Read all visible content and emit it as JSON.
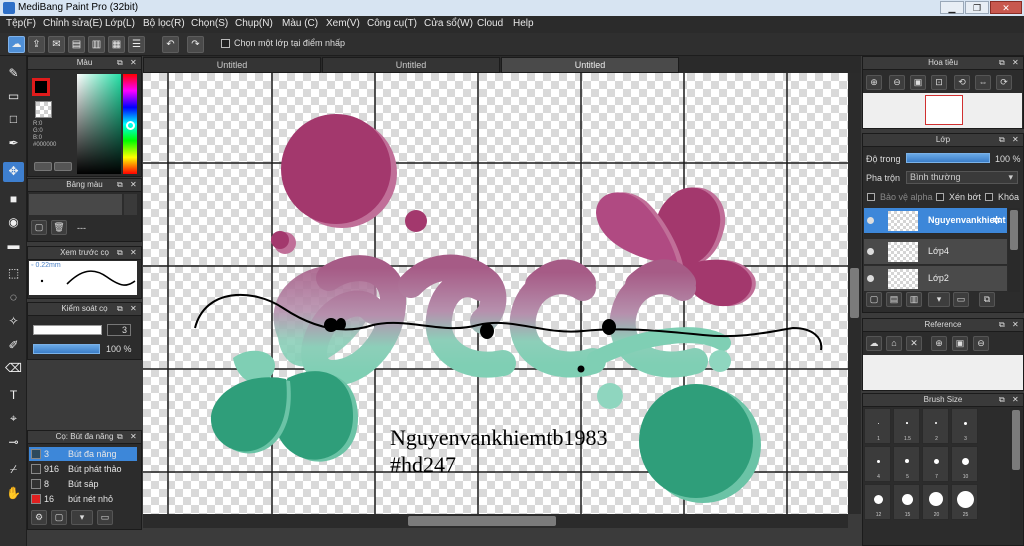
{
  "window": {
    "title": "MediBang Paint Pro (32bit)"
  },
  "menu": [
    "Tệp(F)",
    "Chỉnh sửa(E)",
    "Lớp(L)",
    "Bộ lọc(R)",
    "Chọn(S)",
    "Chụp(N)",
    "Màu (C)",
    "Xem(V)",
    "Công cụ(T)",
    "Cửa sổ(W)",
    "Cloud",
    "Help"
  ],
  "toolbar": {
    "select_layer_option": "Chọn một lớp tại điểm nhấp"
  },
  "left_panels": {
    "color": {
      "title": "Màu",
      "r": "R:0",
      "g": "G:0",
      "b": "B:0",
      "hex": "#000000",
      "fg_color": "#000000",
      "bg_color": "transparent"
    },
    "palette": {
      "title": "Bảng màu",
      "dash": "---"
    },
    "preview": {
      "title": "Xem trước cọ",
      "size": "0.22mm"
    },
    "brush_control": {
      "title": "Kiểm soát cọ",
      "size_value": "3",
      "opacity_value": "100 %"
    },
    "brush_list": {
      "title": "Cọ: Bút đa năng",
      "items": [
        {
          "size": "3",
          "name": "Bút đa năng",
          "color": "#2d4a5c",
          "selected": true
        },
        {
          "size": "916",
          "name": "Bút phát thảo",
          "color": "#333333",
          "selected": false
        },
        {
          "size": "8",
          "name": "Bút sáp",
          "color": "#333333",
          "selected": false
        },
        {
          "size": "16",
          "name": "bút nét nhỏ",
          "color": "#e02020",
          "selected": false
        }
      ]
    }
  },
  "tabs": [
    {
      "label": "Untitled",
      "active": false
    },
    {
      "label": "Untitled",
      "active": false
    },
    {
      "label": "Untitled",
      "active": true
    }
  ],
  "canvas": {
    "signature_line1": "Nguyenvankhiemtb1983",
    "signature_line2": "#hd247",
    "colors": {
      "magenta": "#a3386d",
      "teal": "#2f9e7a",
      "mint": "#7fcfb4"
    }
  },
  "right_panels": {
    "navigator": {
      "title": "Hoa tiêu"
    },
    "layers": {
      "title": "Lớp",
      "opacity_label": "Độ trong",
      "opacity_value": "100 %",
      "blend_label": "Pha trộn",
      "blend_value": "Bình thường",
      "protect_alpha": "Bảo vệ alpha",
      "clipping": "Xén bớt",
      "lock": "Khóa",
      "items": [
        {
          "name": "Nguyenvankhiemt",
          "selected": true
        },
        {
          "name": "Lớp4",
          "selected": false
        },
        {
          "name": "Lớp2",
          "selected": false
        }
      ]
    },
    "reference": {
      "title": "Reference"
    },
    "brush_size": {
      "title": "Brush Size",
      "row1": [
        "1",
        "1.5",
        "2",
        "3"
      ],
      "row2": [
        "4",
        "5",
        "7",
        "10"
      ],
      "row3": [
        "12",
        "15",
        "20",
        "25"
      ]
    }
  }
}
